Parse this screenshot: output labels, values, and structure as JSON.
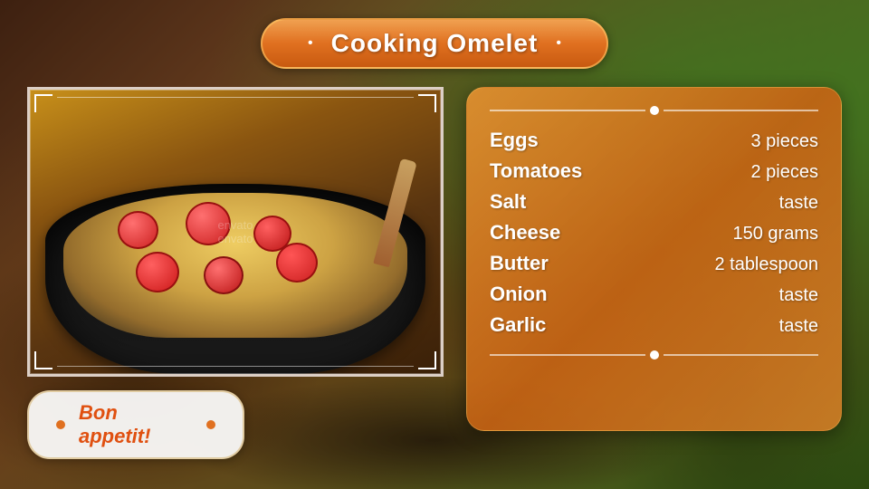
{
  "title": {
    "text": "Cooking Omelet"
  },
  "bon_appetit": {
    "text": "Bon appetit!"
  },
  "ingredients": [
    {
      "name": "Eggs",
      "amount": "3 pieces"
    },
    {
      "name": "Tomatoes",
      "amount": "2 pieces"
    },
    {
      "name": "Salt",
      "amount": "taste"
    },
    {
      "name": "Cheese",
      "amount": "150 grams"
    },
    {
      "name": "Butter",
      "amount": "2 tablespoon"
    },
    {
      "name": "Onion",
      "amount": "taste"
    },
    {
      "name": "Garlic",
      "amount": "taste"
    }
  ],
  "watermark": {
    "line1": "envato",
    "line2": "envato"
  }
}
